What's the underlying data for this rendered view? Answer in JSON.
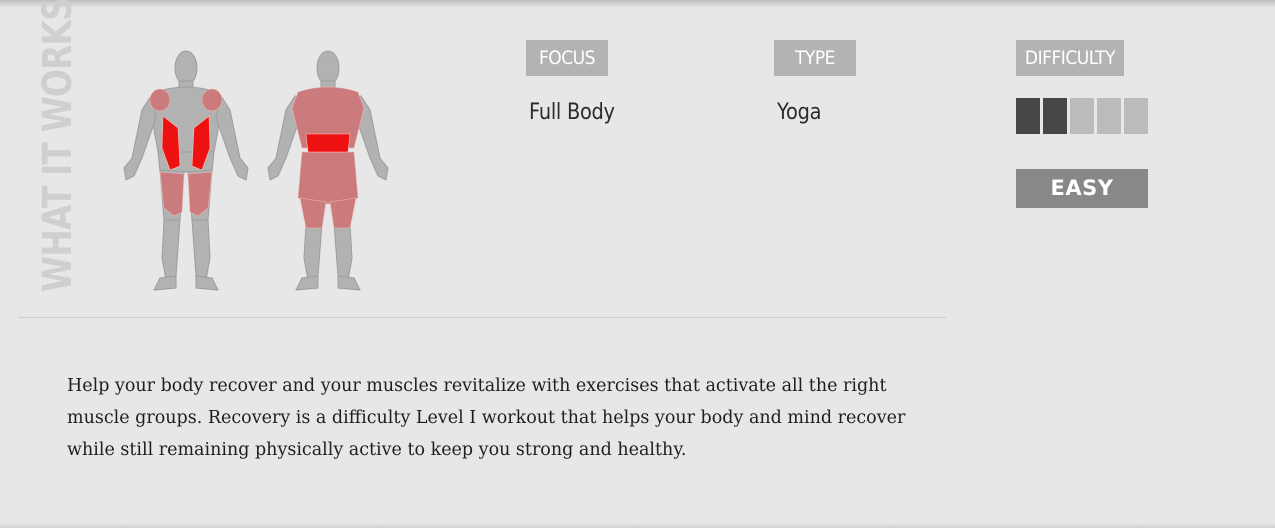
{
  "section": {
    "title": "WHAT IT WORKS"
  },
  "tags": {
    "focus_label": "FOCUS",
    "type_label": "TYPE",
    "difficulty_label": "DIFFICULTY"
  },
  "values": {
    "focus": "Full Body",
    "type": "Yoga"
  },
  "difficulty": {
    "level": 2,
    "max_level": 5,
    "badge": "EASY"
  },
  "description": "Help your body recover and your muscles revitalize with exercises that activate all the right muscle groups. Recovery is a difficulty Level I workout that helps your body and mind recover while still remaining physically active to keep you strong and healthy.",
  "muscle_map": {
    "icon": "human-body-front-back-icon",
    "colors": {
      "body": "#b2b2b2",
      "secondary": "#cc7b7d",
      "primary": "#ee1111"
    }
  }
}
